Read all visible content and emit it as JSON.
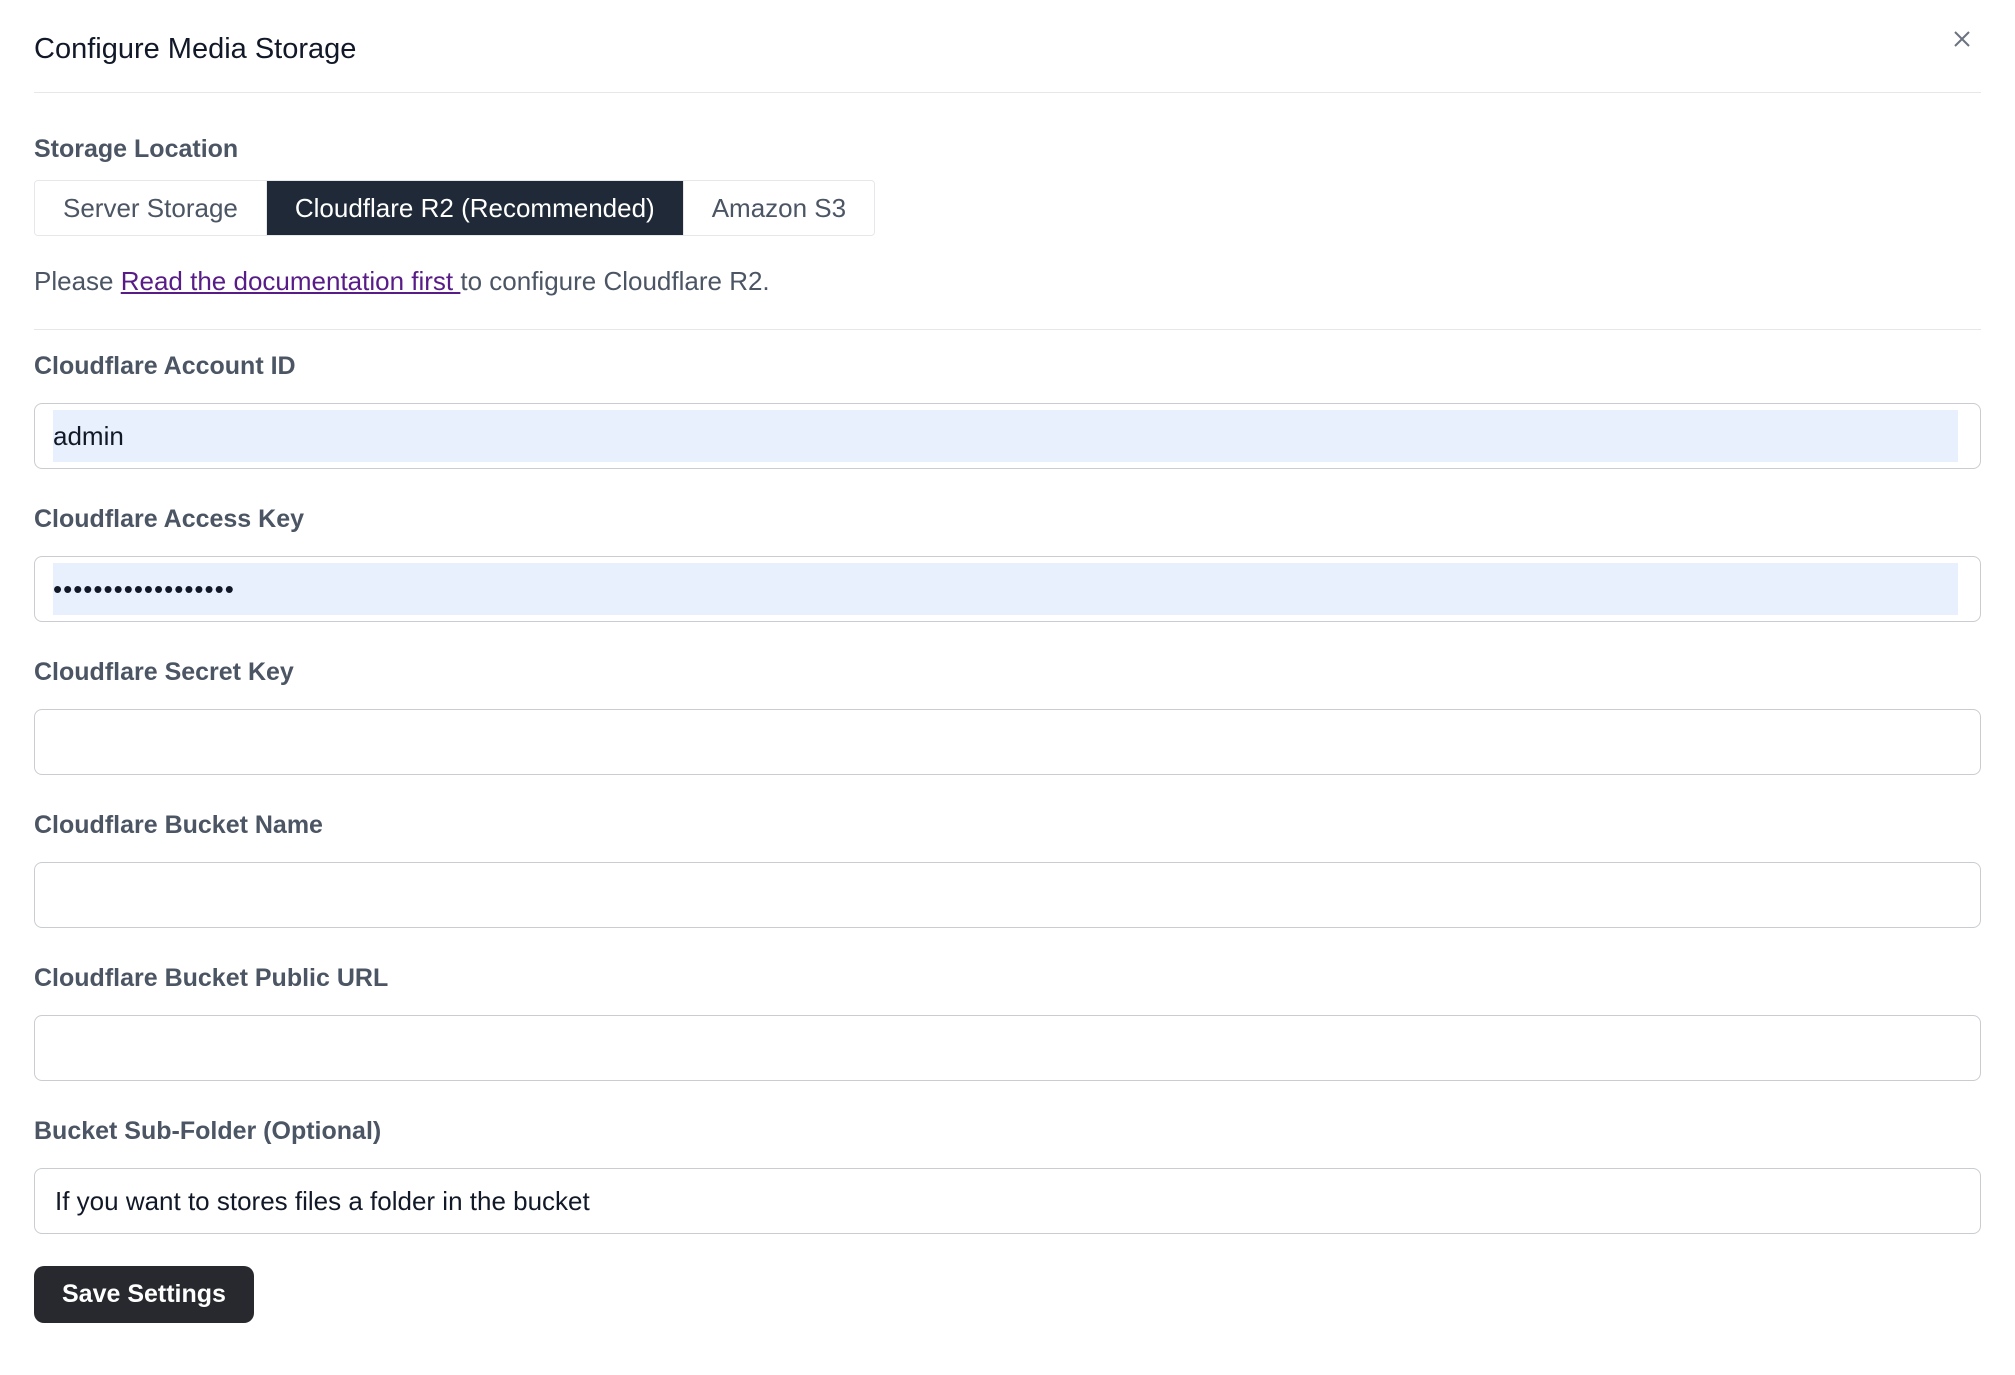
{
  "modal": {
    "title": "Configure Media Storage"
  },
  "storage": {
    "label": "Storage Location",
    "options": [
      {
        "label": "Server Storage",
        "active": false
      },
      {
        "label": "Cloudflare R2 (Recommended)",
        "active": true
      },
      {
        "label": "Amazon S3",
        "active": false
      }
    ]
  },
  "note": {
    "prefix": "Please ",
    "link_text": "Read the documentation first ",
    "suffix": "to configure Cloudflare R2."
  },
  "fields": {
    "account_id": {
      "label": "Cloudflare Account ID",
      "value": "admin"
    },
    "access_key": {
      "label": "Cloudflare Access Key",
      "value": "••••••••••••••••••"
    },
    "secret_key": {
      "label": "Cloudflare Secret Key",
      "value": ""
    },
    "bucket_name": {
      "label": "Cloudflare Bucket Name",
      "value": ""
    },
    "bucket_url": {
      "label": "Cloudflare Bucket Public URL",
      "value": ""
    },
    "sub_folder": {
      "label": "Bucket Sub-Folder (Optional)",
      "value": "",
      "placeholder": "If you want to stores files a folder in the bucket"
    }
  },
  "actions": {
    "save_label": "Save Settings"
  },
  "colors": {
    "active_segment": "#1f2937",
    "save_button": "#27292e",
    "link": "#581c87",
    "autofill": "#e8f0fe"
  }
}
